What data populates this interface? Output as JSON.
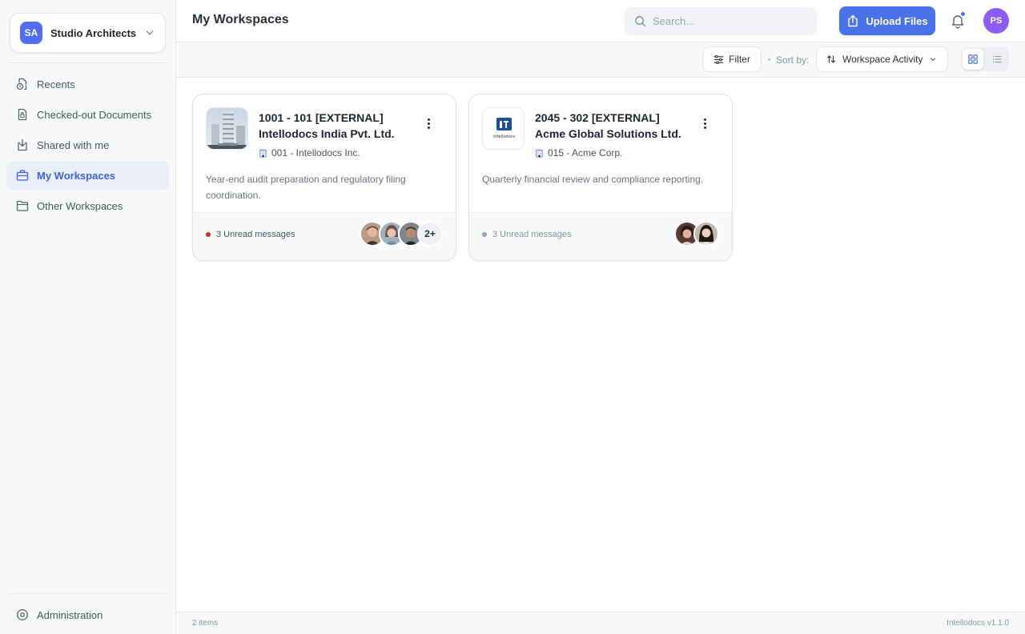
{
  "sidebar": {
    "org": {
      "initials": "SA",
      "name": "Studio Architects"
    },
    "items": [
      {
        "label": "Recents",
        "icon": "recents-icon"
      },
      {
        "label": "Checked-out Documents",
        "icon": "checked-out-document-icon"
      },
      {
        "label": "Shared with me",
        "icon": "shared-icon"
      },
      {
        "label": "My Workspaces",
        "icon": "briefcase-icon",
        "active": true
      },
      {
        "label": "Other Workspaces",
        "icon": "folder-icon"
      }
    ],
    "admin_label": "Administration"
  },
  "header": {
    "title": "My Workspaces",
    "search_placeholder": "Search...",
    "upload_label": "Upload Files",
    "user_initials": "PS"
  },
  "toolbar": {
    "filter_label": "Filter",
    "sort_label": "Sort by:",
    "sort_value": "Workspace Activity",
    "view_mode": "grid"
  },
  "cards": [
    {
      "title_line1": "1001 - 101 [EXTERNAL]",
      "title_line2": "Intellodocs India Pvt. Ltd.",
      "client": "001 - Intellodocs Inc.",
      "description": "Year-end audit preparation and regulatory filing coordination.",
      "unread": "3 Unread messages",
      "unread_color": "#d92d20",
      "more_count": "2+"
    },
    {
      "title_line1": "2045 - 302 [EXTERNAL]",
      "title_line2": "Acme Global Solutions Ltd.",
      "client": "015 - Acme Corp.",
      "description": "Quarterly financial review and compliance reporting.",
      "unread": "3 Unread messages",
      "unread_color": "#98a2b3",
      "logo_text": "intellodocs"
    }
  ],
  "status": {
    "count": "2 items",
    "version": "Intellodocs v1.1.0"
  },
  "colors": {
    "accent": "#4a72e8",
    "active_nav_text": "#3d63dd",
    "user_avatar": "#8b5cf6"
  }
}
